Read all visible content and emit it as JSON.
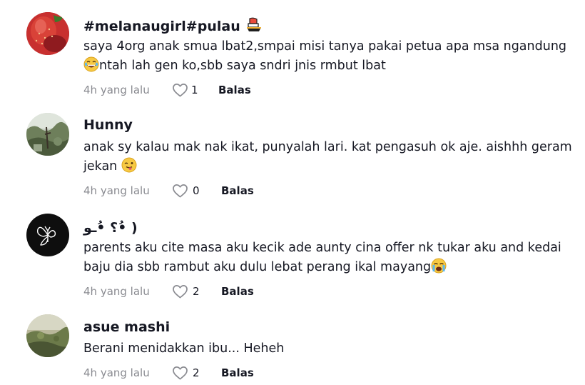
{
  "comments": [
    {
      "username": "#melanaugirl#pulau",
      "text_line1": "saya 4org anak smua lbat2,smpai misi tanya pakai petua apa msa ngandung",
      "text_line2": "ntah lah gen ko,sbb saya sndri jnis rmbut lbat",
      "time": "4h yang lalu",
      "likes": "1",
      "reply": "Balas",
      "avatar": "strawberry-avatar"
    },
    {
      "username": "Hunny",
      "text_line1": "anak sy kalau mak nak ikat, punyalah lari. kat pengasuh ok aje. aishhh geram",
      "text_line2": "jekan",
      "time": "4h yang lalu",
      "likes": "0",
      "reply": "Balas",
      "avatar": "nature-photo-avatar"
    },
    {
      "username": "؟ •ُـﻮ•ُ )",
      "text_line1": "parents aku cite masa aku kecik ade aunty cina offer nk tukar aku and kedai",
      "text_line2": "baju dia sbb rambut aku dulu lebat perang ikal mayang",
      "time": "4h yang lalu",
      "likes": "2",
      "reply": "Balas",
      "avatar": "butterfly-avatar"
    },
    {
      "username": "asue mashi",
      "text_line1": "Berani menidakkan ibu... Heheh",
      "time": "4h yang lalu",
      "likes": "2",
      "reply": "Balas",
      "avatar": "landscape-avatar"
    }
  ],
  "colors": {
    "text": "#161823",
    "meta": "#8a8b91",
    "icon": "#8a8b91"
  }
}
